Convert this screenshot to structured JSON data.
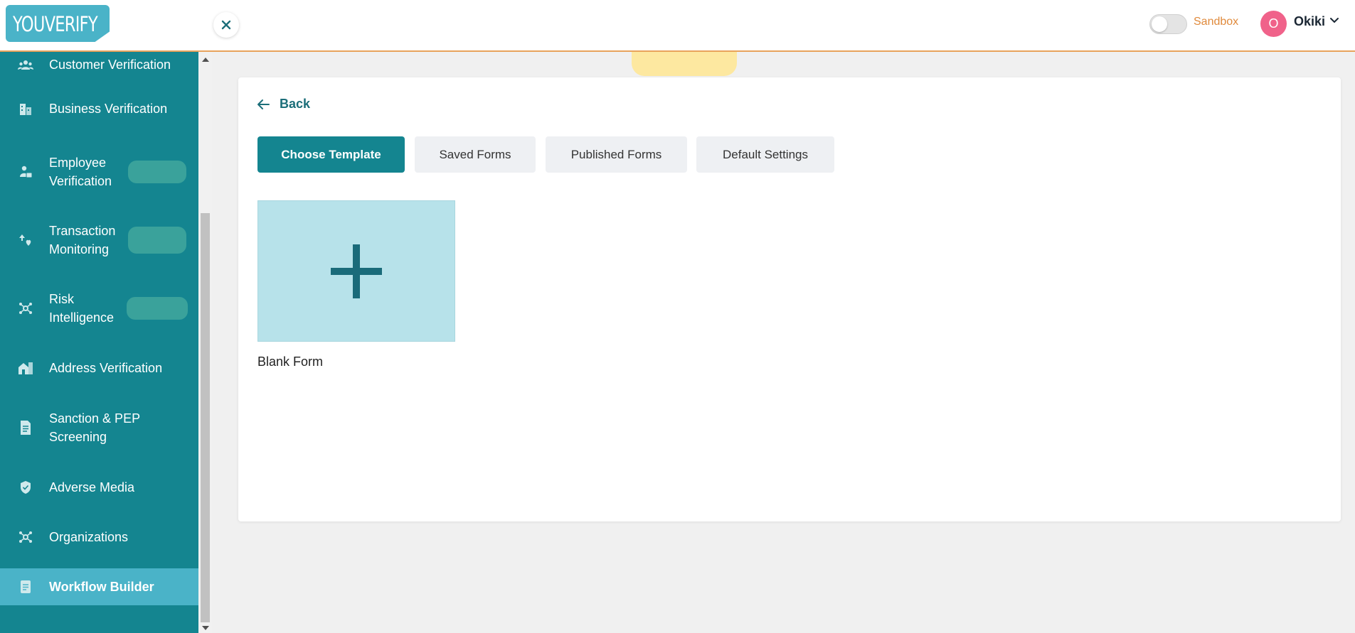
{
  "header": {
    "logo_text": "YOUVERIFY",
    "sandbox_label": "Sandbox",
    "avatar_initial": "O",
    "user_name": "Okiki"
  },
  "sidebar": {
    "items": [
      {
        "label": "Customer Verification",
        "icon": "users-icon"
      },
      {
        "label": "Business Verification",
        "icon": "building-icon"
      },
      {
        "label": "Employee Verification",
        "icon": "employee-icon"
      },
      {
        "label": "Transaction Monitoring",
        "icon": "transaction-icon"
      },
      {
        "label": "Risk Intelligence",
        "icon": "network-icon"
      },
      {
        "label": "Address Verification",
        "icon": "home-icon"
      },
      {
        "label": "Sanction & PEP Screening",
        "icon": "document-icon"
      },
      {
        "label": "Adverse Media",
        "icon": "shield-icon"
      },
      {
        "label": "Organizations",
        "icon": "network-icon"
      },
      {
        "label": "Workflow Builder",
        "icon": "form-icon"
      }
    ]
  },
  "main": {
    "back_label": "Back",
    "tabs": [
      {
        "label": "Choose Template"
      },
      {
        "label": "Saved Forms"
      },
      {
        "label": "Published Forms"
      },
      {
        "label": "Default Settings"
      }
    ],
    "template": {
      "label": "Blank Form"
    }
  },
  "colors": {
    "sidebar": "#148590",
    "active_item": "#4ab3c8",
    "accent_orange": "#e8a35c",
    "tile_bg": "#b7e2ea"
  }
}
